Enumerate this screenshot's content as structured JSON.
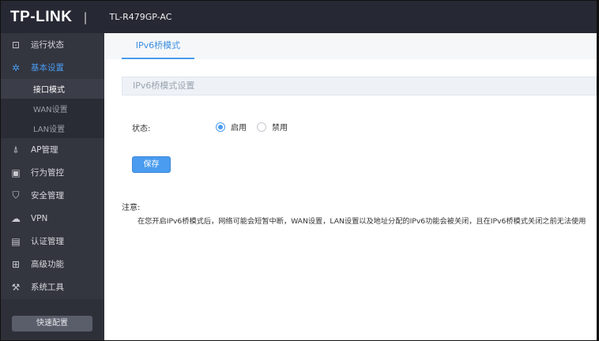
{
  "header": {
    "brand": "TP-LINK",
    "separator": "|",
    "model": "TL-R479GP-AC"
  },
  "sidebar": {
    "items": [
      {
        "label": "运行状态",
        "icon": "monitor-icon"
      },
      {
        "label": "基本设置",
        "icon": "gear-icon",
        "expanded": true
      },
      {
        "label": "AP管理",
        "icon": "antenna-icon"
      },
      {
        "label": "行为管控",
        "icon": "behavior-icon"
      },
      {
        "label": "安全管理",
        "icon": "shield-icon"
      },
      {
        "label": "VPN",
        "icon": "cloud-icon"
      },
      {
        "label": "认证管理",
        "icon": "badge-icon"
      },
      {
        "label": "高级功能",
        "icon": "grid-icon"
      },
      {
        "label": "系统工具",
        "icon": "tools-icon"
      }
    ],
    "subitems": [
      {
        "label": "接口模式",
        "active": true
      },
      {
        "label": "WAN设置"
      },
      {
        "label": "LAN设置"
      }
    ],
    "quick_setup": "快速配置"
  },
  "main": {
    "tab": "IPv6桥模式",
    "section_title": "IPv6桥模式设置",
    "status_label": "状态:",
    "options": [
      {
        "label": "启用",
        "selected": true
      },
      {
        "label": "禁用",
        "selected": false
      }
    ],
    "save": "保存",
    "note_title": "注意:",
    "note": "在您开启IPv6桥模式后，网络可能会短暂中断，WAN设置，LAN设置以及地址分配的IPv6功能会被关闭，且在IPv6桥模式关闭之前无法使用"
  },
  "colors": {
    "accent": "#4a9cf0",
    "header": "#262833",
    "sidebar": "#33353f"
  }
}
